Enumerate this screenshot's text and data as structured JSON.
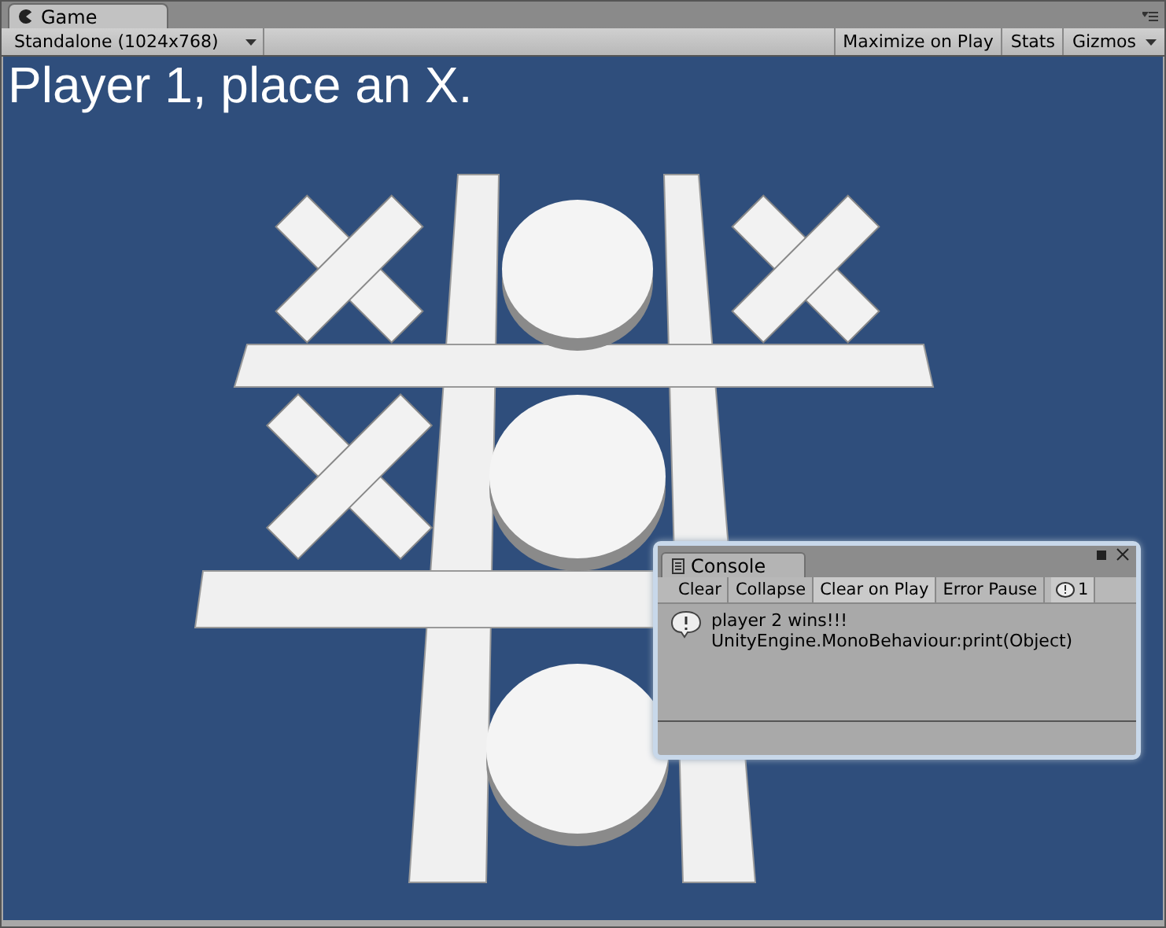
{
  "tab": {
    "title": "Game",
    "selected": true
  },
  "toolbar": {
    "resolution": "Standalone (1024x768)",
    "buttons": [
      {
        "label": "Maximize on Play",
        "on": false
      },
      {
        "label": "Stats",
        "on": false
      },
      {
        "label": "Gizmos",
        "on": false
      }
    ]
  },
  "game": {
    "message": "Player 1, place an X.",
    "board": [
      {
        "kind": "x"
      },
      {
        "kind": "o"
      },
      {
        "kind": "x"
      },
      {
        "kind": "x"
      },
      {
        "kind": "o"
      },
      {
        "kind": "empty"
      },
      {
        "kind": "empty"
      },
      {
        "kind": "o"
      },
      {
        "kind": "empty"
      }
    ]
  },
  "console": {
    "title": "Console",
    "buttons": [
      {
        "label": "Clear",
        "kind": "button"
      },
      {
        "label": "Collapse",
        "kind": "toggle",
        "on": false
      },
      {
        "label": "Clear on Play",
        "kind": "toggle",
        "on": true
      },
      {
        "label": "Error Pause",
        "kind": "toggle",
        "on": false
      }
    ],
    "error_count": "1",
    "entries": [
      {
        "message": "player 2 wins!!!",
        "source": "UnityEngine.MonoBehaviour:print(Object)"
      }
    ]
  }
}
